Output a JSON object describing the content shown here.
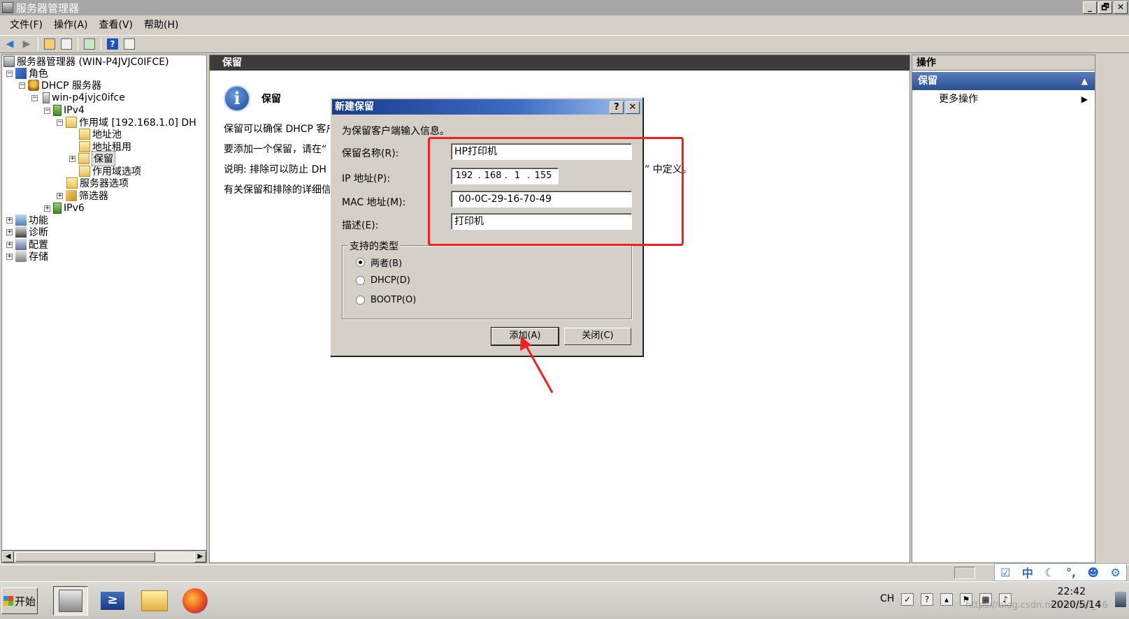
{
  "window": {
    "title": "服务器管理器",
    "min": "_",
    "max": "🗗",
    "close": "✕"
  },
  "menu": [
    "文件(F)",
    "操作(A)",
    "查看(V)",
    "帮助(H)"
  ],
  "tree": {
    "root": "服务器管理器 (WIN-P4JVJC0IFCE)",
    "roles": "角色",
    "dhcp": "DHCP 服务器",
    "host": "win-p4jvjc0ifce",
    "ipv4": "IPv4",
    "scope": "作用域 [192.168.1.0] DH",
    "pool": "地址池",
    "leases": "地址租用",
    "reservations": "保留",
    "scope_options": "作用域选项",
    "server_options": "服务器选项",
    "filters": "筛选器",
    "ipv6": "IPv6",
    "features": "功能",
    "diagnostics": "诊断",
    "configuration": "配置",
    "storage": "存储"
  },
  "content": {
    "header": "保留",
    "title": "保留",
    "line1": "保留可以确保 DHCP 客户",
    "line2": "要添加一个保留，请在“",
    "line3": "说明: 排除可以防止 DH",
    "line3_tail": "” 中定义。",
    "line4": "有关保留和排除的详细信"
  },
  "actions": {
    "header": "操作",
    "group": "保留",
    "more": "更多操作"
  },
  "dialog": {
    "title": "新建保留",
    "help": "?",
    "close": "✕",
    "instruction": "为保留客户端输入信息。",
    "name_label": "保留名称(R):",
    "name_value": "HP打印机",
    "ip_label": "IP 地址(P):",
    "ip_octets": [
      "192",
      "168",
      "1",
      "155"
    ],
    "mac_label": "MAC 地址(M):",
    "mac_value": "00-0C-29-16-70-49",
    "desc_label": "描述(E):",
    "desc_value": "打印机",
    "types_legend": "支持的类型",
    "types": [
      "两者(B)",
      "DHCP(D)",
      "BOOTP(O)"
    ],
    "selected_type": "两者(B)",
    "add_button": "添加(A)",
    "close_button": "关闭(C)"
  },
  "taskbar": {
    "start": "开始",
    "lang": "CH",
    "time": "22:42",
    "date": "2020/5/14",
    "watermark": "https://blog.csdn.net/weixin_46"
  },
  "ime": {
    "mode": "中"
  },
  "colors": {
    "annotation_red": "#ee2020",
    "dialog_title": "#1a3c8a",
    "action_group": "#3a5fa8"
  }
}
